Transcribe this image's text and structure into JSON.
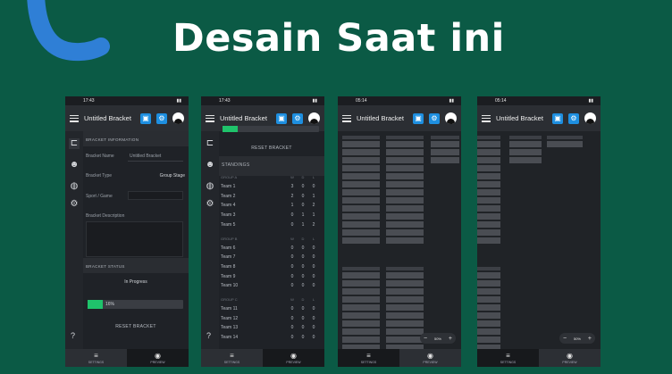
{
  "headline": "Desain Saat ini",
  "app": {
    "title": "Untitled Bracket",
    "save_icon": "save-icon",
    "settings_icon": "gear-icon"
  },
  "statusbars": [
    {
      "time": "17:43"
    },
    {
      "time": "17:43"
    },
    {
      "time": "05:14"
    },
    {
      "time": "05:14"
    }
  ],
  "bottom_nav": {
    "settings": "SETTINGS",
    "preview": "PREVIEW"
  },
  "phone1": {
    "section_info": "BRACKET INFORMATION",
    "bracket_name_label": "Bracket Name",
    "bracket_name_value": "Untitled Bracket",
    "bracket_type_label": "Bracket Type",
    "bracket_type_value": "Group Stage",
    "sport_label": "Sport / Game",
    "description_label": "Bracket Description",
    "section_status": "BRACKET STATUS",
    "status_value": "In Progress",
    "progress_text": "16%",
    "progress_fraction": 0.16,
    "reset_label": "RESET BRACKET",
    "help": "?"
  },
  "phone2": {
    "reset_label": "RESET BRACKET",
    "section_standings": "STANDINGS",
    "col_w": "W",
    "col_d": "D",
    "col_l": "L",
    "groups": [
      {
        "name": "GROUP A",
        "rows": [
          {
            "team": "Team 1",
            "w": "3",
            "d": "0",
            "l": "0"
          },
          {
            "team": "Team 2",
            "w": "2",
            "d": "0",
            "l": "1"
          },
          {
            "team": "Team 4",
            "w": "1",
            "d": "0",
            "l": "2"
          },
          {
            "team": "Team 3",
            "w": "0",
            "d": "1",
            "l": "1"
          },
          {
            "team": "Team 5",
            "w": "0",
            "d": "1",
            "l": "2"
          }
        ]
      },
      {
        "name": "GROUP B",
        "rows": [
          {
            "team": "Team 6",
            "w": "0",
            "d": "0",
            "l": "0"
          },
          {
            "team": "Team 7",
            "w": "0",
            "d": "0",
            "l": "0"
          },
          {
            "team": "Team 8",
            "w": "0",
            "d": "0",
            "l": "0"
          },
          {
            "team": "Team 9",
            "w": "0",
            "d": "0",
            "l": "0"
          },
          {
            "team": "Team 10",
            "w": "0",
            "d": "0",
            "l": "0"
          }
        ]
      },
      {
        "name": "GROUP C",
        "rows": [
          {
            "team": "Team 11",
            "w": "0",
            "d": "0",
            "l": "0"
          },
          {
            "team": "Team 12",
            "w": "0",
            "d": "0",
            "l": "0"
          },
          {
            "team": "Team 13",
            "w": "0",
            "d": "0",
            "l": "0"
          },
          {
            "team": "Team 14",
            "w": "0",
            "d": "0",
            "l": "0"
          }
        ]
      }
    ]
  },
  "phone3": {
    "zoom": "50%",
    "minus": "−",
    "plus": "+"
  },
  "phone4": {
    "zoom": "50%",
    "minus": "−",
    "plus": "+"
  }
}
